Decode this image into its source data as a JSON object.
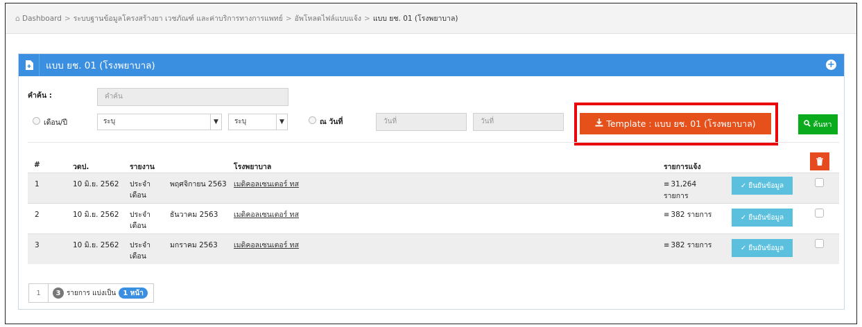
{
  "breadcrumb": {
    "home": "Dashboard",
    "items": [
      "ระบบฐานข้อมูลโครงสร้างยา เวชภัณฑ์ และค่าบริการทางการแพทย์",
      "อัพโหลดไฟล์แบบแจ้ง"
    ],
    "current": "แบบ ยช. 01 (โรงพยาบาล)"
  },
  "panel": {
    "title": "แบบ ยช. 01 (โรงพยาบาล)"
  },
  "filters": {
    "search_label": "คำค้น :",
    "search_placeholder": "คำค้น",
    "month_year_label": "เดือน/ปี",
    "month_select": "ระบุ",
    "year_select": "ระบุ",
    "on_date_label": "ณ วันที่",
    "date_from_placeholder": "วันที่",
    "date_to_placeholder": "วันที่"
  },
  "buttons": {
    "template": "Template : แบบ ยช. 01 (โรงพยาบาล)",
    "search": "ค้นหา",
    "confirm": "ยืนยันข้อมูล"
  },
  "table": {
    "headers": [
      "#",
      "วดป.",
      "รายงาน",
      "โรงพยาบาล",
      "รายการแจ้ง"
    ],
    "rows": [
      {
        "num": "1",
        "date": "10 มิ.ย. 2562",
        "report": "ประจำ",
        "report2": "เดือน",
        "period": "พฤศจิกายน 2563",
        "hospital": "เมดิคอลเซนเตอร์ ทส",
        "count": "31,264",
        "count2": "รายการ"
      },
      {
        "num": "2",
        "date": "10 มิ.ย. 2562",
        "report": "ประจำ",
        "report2": "เดือน",
        "period": "ธันวาคม 2563",
        "hospital": "เมดิคอลเซนเตอร์ ทส",
        "count": "382 รายการ",
        "count2": ""
      },
      {
        "num": "3",
        "date": "10 มิ.ย. 2562",
        "report": "ประจำ",
        "report2": "เดือน",
        "period": "มกราคม 2563",
        "hospital": "เมดิคอลเซนเตอร์ ทส",
        "count": "382 รายการ",
        "count2": ""
      }
    ]
  },
  "pager": {
    "page": "1",
    "total_items": "3",
    "text_mid": "รายการ แบ่งเป็น",
    "pages": "1 หน้า"
  },
  "colors": {
    "header_blue": "#3b8fe0",
    "template_orange": "#e6501b",
    "highlight_red": "#e8000b",
    "search_green": "#0bab1e",
    "confirm_cyan": "#5bc0de",
    "delete_red": "#e54b1f"
  },
  "icons": {
    "home": "home-icon",
    "doc": "file-add-icon",
    "plus": "plus-circle-icon",
    "download": "download-icon",
    "search": "search-icon",
    "trash": "trash-icon",
    "list": "list-icon",
    "check": "check-circle-icon"
  }
}
